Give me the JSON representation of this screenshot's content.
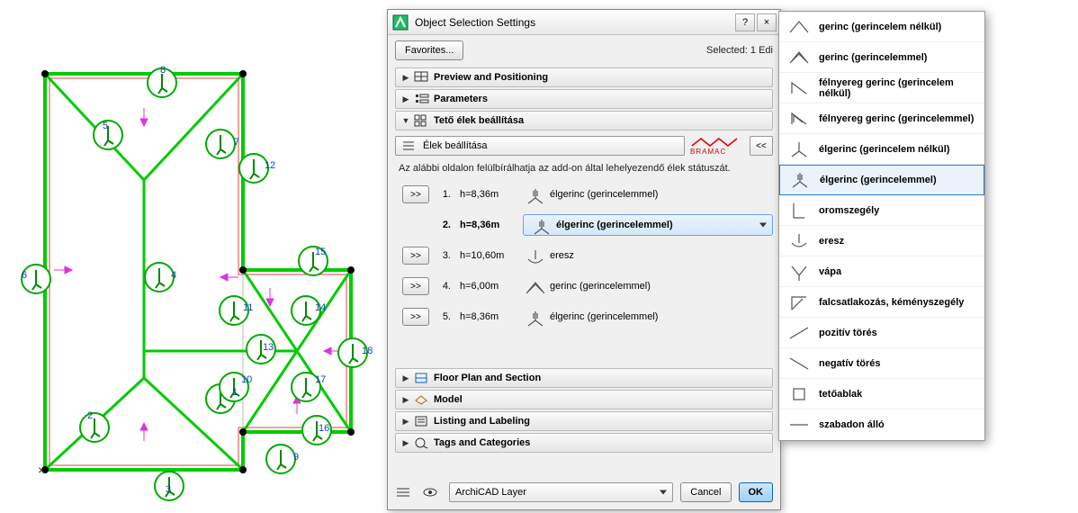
{
  "dialog": {
    "title": "Object Selection Settings",
    "favorites_btn": "Favorites...",
    "selected_text": "Selected: 1 Edi",
    "sections": {
      "preview": "Preview and Positioning",
      "params": "Parameters",
      "edges_hu": "Tető élek beállítása",
      "floorplan": "Floor Plan and Section",
      "model": "Model",
      "listing": "Listing and Labeling",
      "tags": "Tags and Categories"
    },
    "edge_drop_label": "Élek beállítása",
    "brand": "BRAMAC",
    "back_btn": "<<",
    "subtext": "Az alábbi oldalon felülbírálhatja az add-on által lehelyezendő élek státuszát.",
    "rows": [
      {
        "go": ">>",
        "n": "1.",
        "h": "h=8,36m",
        "type": "élgerinc (gerincelemmel)",
        "bold": false,
        "dropdown": false
      },
      {
        "go": "",
        "n": "2.",
        "h": "h=8,36m",
        "type": "élgerinc (gerincelemmel)",
        "bold": true,
        "dropdown": true
      },
      {
        "go": ">>",
        "n": "3.",
        "h": "h=10,60m",
        "type": "eresz",
        "bold": false,
        "dropdown": false
      },
      {
        "go": ">>",
        "n": "4.",
        "h": "h=6,00m",
        "type": "gerinc (gerincelemmel)",
        "bold": false,
        "dropdown": false
      },
      {
        "go": ">>",
        "n": "5.",
        "h": "h=8,36m",
        "type": "élgerinc (gerincelemmel)",
        "bold": false,
        "dropdown": false
      }
    ],
    "layer_label": "ArchiCAD Layer",
    "cancel": "Cancel",
    "ok": "OK"
  },
  "popup": {
    "items": [
      "gerinc (gerincelem nélkül)",
      "gerinc (gerincelemmel)",
      "félnyereg gerinc (gerincelem nélkül)",
      "félnyereg gerinc (gerincelemmel)",
      "élgerinc (gerincelem nélkül)",
      "élgerinc (gerincelemmel)",
      "oromszegély",
      "eresz",
      "vápa",
      "falcsatlakozás, kéményszegély",
      "pozitív törés",
      "negatív törés",
      "tetőablak",
      "szabadon álló"
    ],
    "selected_index": 5
  },
  "roof": {
    "labels": [
      "1",
      "2",
      "3",
      "4",
      "5",
      "6",
      "7",
      "8",
      "9",
      "10",
      "11",
      "12",
      "13",
      "14",
      "15",
      "16",
      "17",
      "18"
    ]
  }
}
